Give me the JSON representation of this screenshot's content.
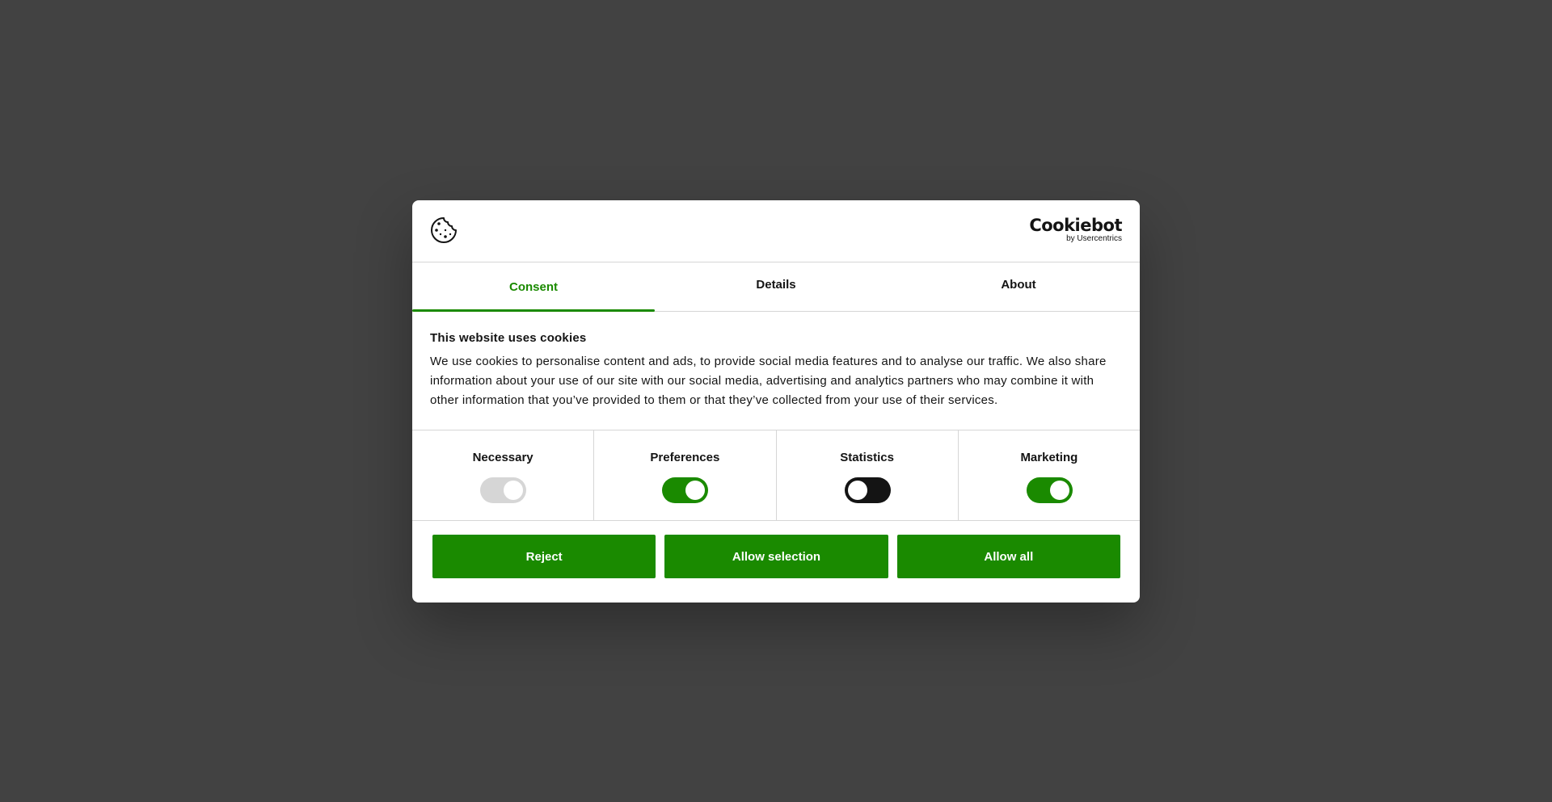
{
  "colors": {
    "overlay": "#424242",
    "accent": "#1a8a00",
    "toggle_disabled": "#d6d6d6",
    "toggle_off": "#141414",
    "text": "#141414"
  },
  "header": {
    "cookie_icon": "cookie-icon",
    "brand_name": "Cookiebot",
    "brand_sub": "by Usercentrics"
  },
  "tabs": [
    {
      "label": "Consent",
      "active": true
    },
    {
      "label": "Details",
      "active": false
    },
    {
      "label": "About",
      "active": false
    }
  ],
  "consent": {
    "title": "This website uses cookies",
    "text": "We use cookies to personalise content and ads, to provide social media features and to analyse our traffic. We also share information about your use of our site with our social media, advertising and analytics partners who may combine it with other information that you’ve provided to them or that they’ve collected from your use of their services."
  },
  "categories": [
    {
      "label": "Necessary",
      "checked": true,
      "disabled": true
    },
    {
      "label": "Preferences",
      "checked": true,
      "disabled": false
    },
    {
      "label": "Statistics",
      "checked": false,
      "disabled": false
    },
    {
      "label": "Marketing",
      "checked": true,
      "disabled": false
    }
  ],
  "buttons": {
    "reject": "Reject",
    "allow_selection": "Allow selection",
    "allow_all": "Allow all"
  }
}
